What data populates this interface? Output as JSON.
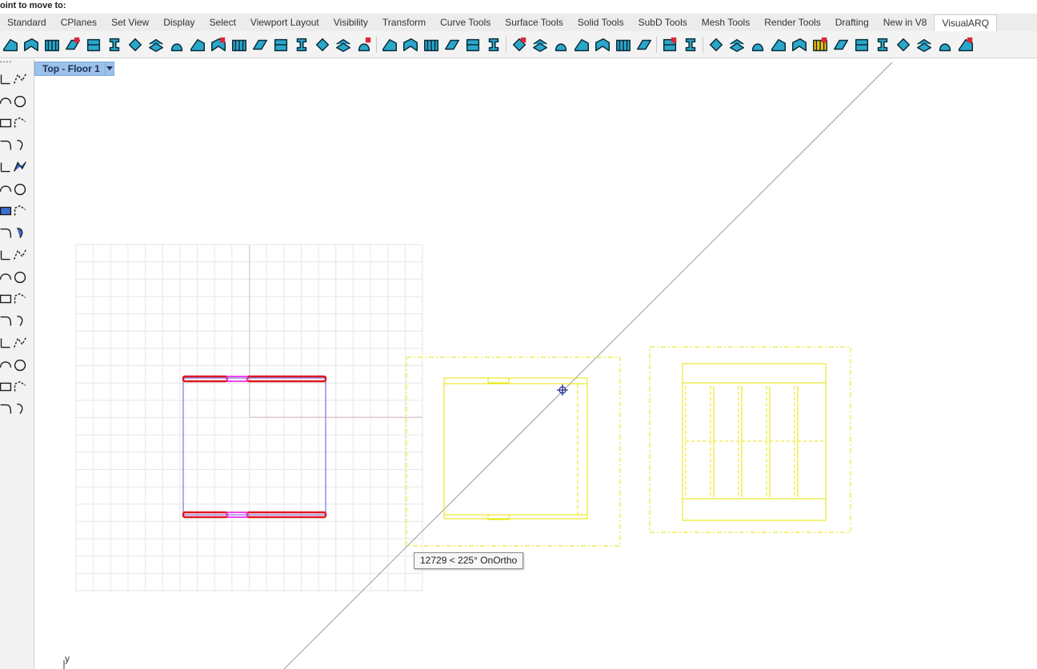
{
  "command": {
    "prompt": "oint to move to:"
  },
  "tabs": [
    {
      "label": "Standard",
      "active": false
    },
    {
      "label": "CPlanes",
      "active": false
    },
    {
      "label": "Set View",
      "active": false
    },
    {
      "label": "Display",
      "active": false
    },
    {
      "label": "Select",
      "active": false
    },
    {
      "label": "Viewport Layout",
      "active": false
    },
    {
      "label": "Visibility",
      "active": false
    },
    {
      "label": "Transform",
      "active": false
    },
    {
      "label": "Curve Tools",
      "active": false
    },
    {
      "label": "Surface Tools",
      "active": false
    },
    {
      "label": "Solid Tools",
      "active": false
    },
    {
      "label": "SubD Tools",
      "active": false
    },
    {
      "label": "Mesh Tools",
      "active": false
    },
    {
      "label": "Render Tools",
      "active": false
    },
    {
      "label": "Drafting",
      "active": false
    },
    {
      "label": "New in V8",
      "active": false
    },
    {
      "label": "VisualARQ",
      "active": true
    }
  ],
  "toolbar": {
    "icons": [
      "wall-icon",
      "wall-curve-icon",
      "curtain-wall-icon",
      "roof-icon",
      "facade-icon",
      "beam-icon",
      "column-icon",
      "slab-icon",
      "slab-edit-icon",
      "column-profile-icon",
      "structural-beam-icon",
      "column-icon-2",
      "door-icon",
      "window-icon",
      "opening-icon",
      "stair-icon",
      "stair-curve-icon",
      "railing-icon",
      "separator",
      "railing-post-icon",
      "slab-flat-icon",
      "level-up-icon",
      "level-down-icon",
      "level-add-icon",
      "level-remove-icon",
      "separator",
      "roof-line-icon",
      "roof-gable-icon",
      "roof-edit-icon",
      "roof-hip-icon",
      "roof-shed-icon",
      "roof-mansard-icon",
      "roof-curve-icon",
      "separator",
      "furniture-icon",
      "element-icon",
      "separator",
      "space-icon",
      "space-edit-icon",
      "space-boundary-icon",
      "space-volume-icon",
      "space-area-icon",
      "table-icon",
      "tag-icon",
      "section-icon",
      "elevation-icon",
      "dimension-icon",
      "annotation-icon",
      "grid-icon",
      "more-icon"
    ],
    "colors": {
      "icon_fill": "#2aa7c9",
      "icon_stroke": "#0b2a3a",
      "accent_red": "#d9283a",
      "accent_yellow": "#f5c400"
    }
  },
  "left_toolbar": {
    "icons": [
      "point-icon",
      "polyline-icon",
      "arc-icon",
      "circle-icon",
      "rectangle-icon",
      "curve-edit-icon",
      "fillet-icon",
      "revolve-icon",
      "box-icon",
      "sphere-icon",
      "surface-icon",
      "patch-icon",
      "explode-icon",
      "split-icon",
      "boolean-icon",
      "sphere-array-icon",
      "move-icon",
      "rotate-icon",
      "align-icon",
      "scale-icon",
      "extrude-icon",
      "array-icon",
      "group-icon",
      "block-icon",
      "stack-icon",
      "properties-icon",
      "solid-icon",
      "wireframe-icon",
      "analysis-icon",
      "cylinder-icon",
      "dimension-icon",
      "more-icon"
    ]
  },
  "viewport": {
    "title": "Top - Floor 1",
    "dropdown_icon": "chevron-down-icon",
    "tooltip": "12729 < 225° OnOrtho",
    "axis_label": "y",
    "colors": {
      "grid": "#e6e6e6",
      "wall_selected": "#e0161f",
      "opening": "#f032e6",
      "outline": "#5a5ad8",
      "floor_plan": "#e6e600",
      "crosshair": "#1b2a8f"
    }
  }
}
